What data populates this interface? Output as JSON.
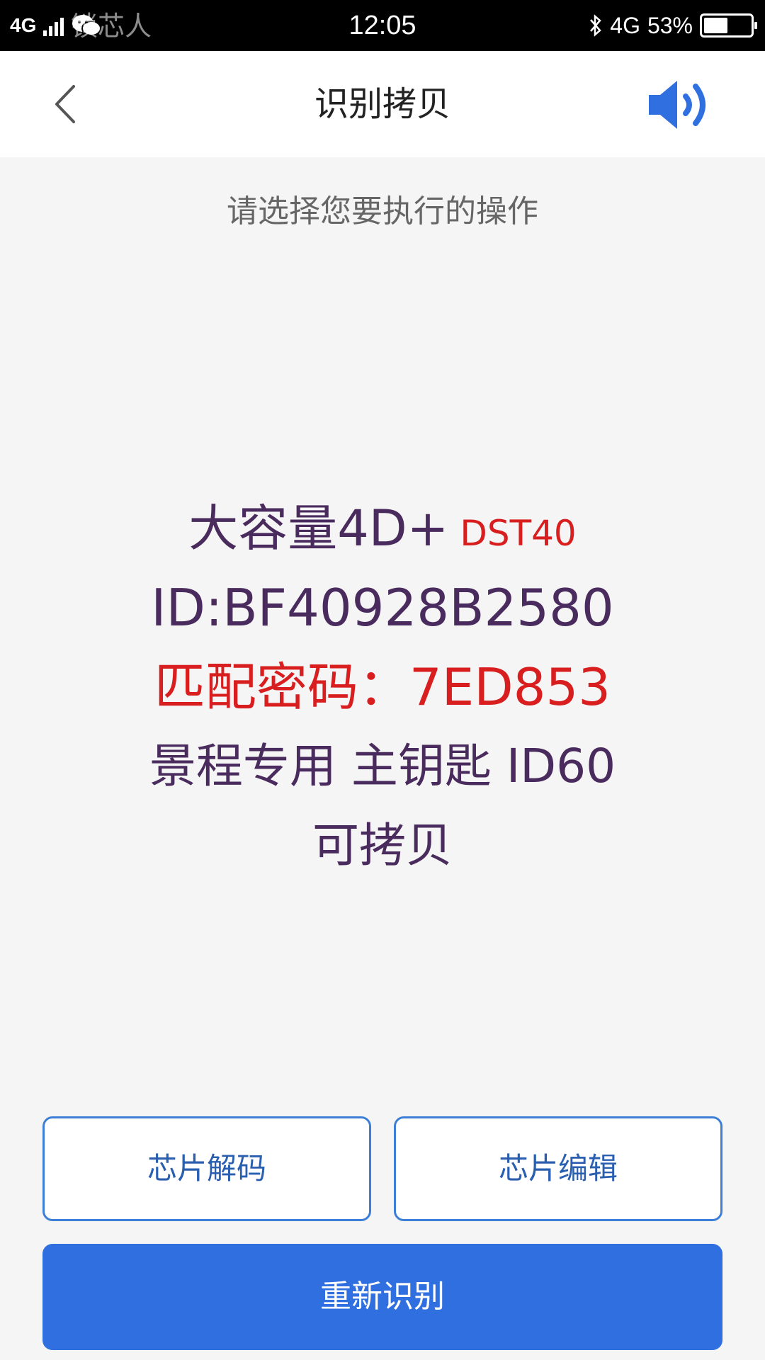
{
  "status_bar": {
    "network_left": "4G",
    "watermark": "锁芯人",
    "time": "12:05",
    "network_right": "4G",
    "battery": "53%",
    "battery_level": 0.53
  },
  "header": {
    "back_icon": "chevron-left-icon",
    "title": "识别拷贝",
    "sound_icon": "speaker-icon",
    "accent_color": "#2f6fe0"
  },
  "instruction": "请选择您要执行的操作",
  "result": {
    "chip_type": "大容量4D+",
    "chip_model": "DST40",
    "id_line": "ID:BF40928B2580",
    "password_line": "匹配密码：7ED853",
    "vehicle_line": "景程专用 主钥匙  ID60",
    "copy_status": "可拷贝"
  },
  "buttons": {
    "chip_decode": "芯片解码",
    "chip_edit": "芯片编辑",
    "re_identify": "重新识别"
  }
}
